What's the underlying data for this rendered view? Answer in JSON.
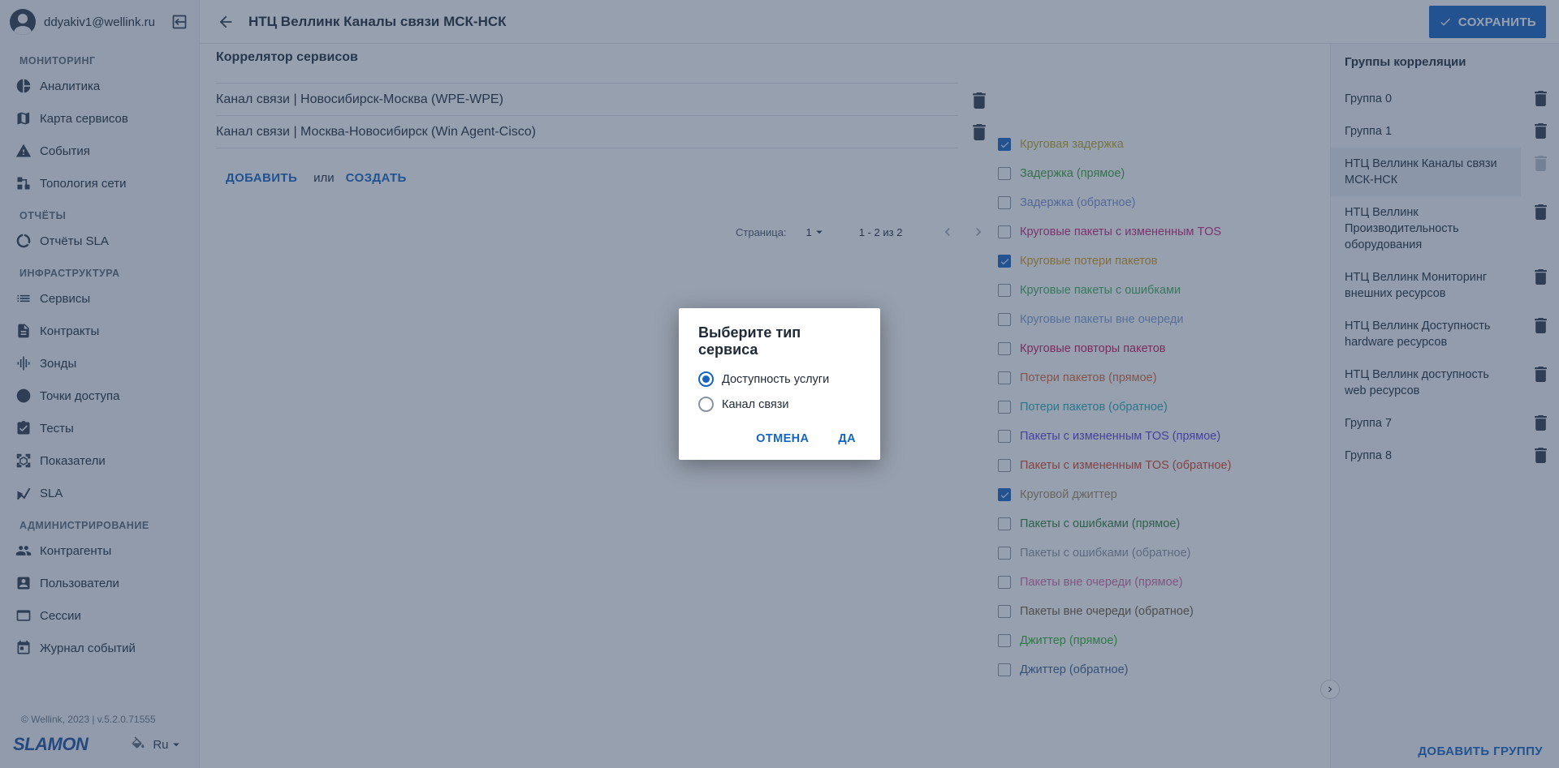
{
  "user": {
    "email": "ddyakiv1@wellink.ru"
  },
  "sidebar": {
    "sections": [
      {
        "title": "МОНИТОРИНГ",
        "items": [
          "Аналитика",
          "Карта сервисов",
          "События",
          "Топология сети"
        ]
      },
      {
        "title": "ОТЧЁТЫ",
        "items": [
          "Отчёты SLA"
        ]
      },
      {
        "title": "ИНФРАСТРУКТУРА",
        "items": [
          "Сервисы",
          "Контракты",
          "Зонды",
          "Точки доступа",
          "Тесты",
          "Показатели",
          "SLA"
        ]
      },
      {
        "title": "АДМИНИСТРИРОВАНИЕ",
        "items": [
          "Контрагенты",
          "Пользователи",
          "Сессии",
          "Журнал событий"
        ]
      }
    ],
    "copyright": "© Wellink, 2023 | v.5.2.0.71555",
    "logo": "SLAMON",
    "language": "Ru"
  },
  "header": {
    "title": "НТЦ Веллинк Каналы связи МСК-НСК",
    "save_label": "СОХРАНИТЬ"
  },
  "main": {
    "section_title": "Коррелятор сервисов",
    "services": [
      "Канал связи | Новосибирск-Москва (WPE-WPE)",
      "Канал связи | Москва-Новосибирск (Win Agent-Cisco)"
    ],
    "add_label": "ДОБАВИТЬ",
    "or_label": "или",
    "create_label": "СОЗДАТЬ",
    "pager": {
      "label": "Страница:",
      "page": "1",
      "range": "1 - 2 из 2"
    }
  },
  "metrics": [
    {
      "label": "Круговая задержка",
      "checked": true,
      "color": "#b8a82a"
    },
    {
      "label": "Задержка (прямое)",
      "checked": false,
      "color": "#3aa03a"
    },
    {
      "label": "Задержка (обратное)",
      "checked": false,
      "color": "#7a8fcf"
    },
    {
      "label": "Круговые пакеты с измененным TOS",
      "checked": false,
      "color": "#c2277a"
    },
    {
      "label": "Круговые потери пакетов",
      "checked": true,
      "color": "#d49a1f"
    },
    {
      "label": "Круговые пакеты с ошибками",
      "checked": false,
      "color": "#3fae5a"
    },
    {
      "label": "Круговые пакеты вне очереди",
      "checked": false,
      "color": "#7c9cd6"
    },
    {
      "label": "Круговые повторы пакетов",
      "checked": false,
      "color": "#c2185b"
    },
    {
      "label": "Потери пакетов (прямое)",
      "checked": false,
      "color": "#d2693a"
    },
    {
      "label": "Потери пакетов (обратное)",
      "checked": false,
      "color": "#2aa8b0"
    },
    {
      "label": "Пакеты с измененным TOS (прямое)",
      "checked": false,
      "color": "#5a3fd6"
    },
    {
      "label": "Пакеты с измененным TOS (обратное)",
      "checked": false,
      "color": "#d2452a"
    },
    {
      "label": "Круговой джиттер",
      "checked": true,
      "color": "#9c8a63"
    },
    {
      "label": "Пакеты с ошибками (прямое)",
      "checked": false,
      "color": "#2e7d3a"
    },
    {
      "label": "Пакеты с ошибками (обратное)",
      "checked": false,
      "color": "#8a939d"
    },
    {
      "label": "Пакеты вне очереди (прямое)",
      "checked": false,
      "color": "#d06aa0"
    },
    {
      "label": "Пакеты вне очереди (обратное)",
      "checked": false,
      "color": "#6b5a3a"
    },
    {
      "label": "Джиттер (прямое)",
      "checked": false,
      "color": "#2fb02f"
    },
    {
      "label": "Джиттер (обратное)",
      "checked": false,
      "color": "#3a5f8f"
    }
  ],
  "groups": {
    "title": "Группы корреляции",
    "items": [
      "Группа 0",
      "Группа 1",
      "НТЦ Веллинк Каналы связи МСК-НСК",
      "НТЦ Веллинк Производительность оборудования",
      "НТЦ Веллинк Мониторинг внешних ресурсов",
      "НТЦ Веллинк Доступность hardware ресурсов",
      "НТЦ Веллинк доступность web ресурсов",
      "Группа 7",
      "Группа 8"
    ],
    "active_index": 2,
    "add_label": "ДОБАВИТЬ ГРУППУ"
  },
  "dialog": {
    "title": "Выберите тип сервиса",
    "options": [
      "Доступность услуги",
      "Канал связи"
    ],
    "selected": 0,
    "cancel_label": "ОТМЕНА",
    "ok_label": "ДА"
  },
  "colors": {
    "accent": "#1565c0",
    "overlay": "#30425f"
  }
}
